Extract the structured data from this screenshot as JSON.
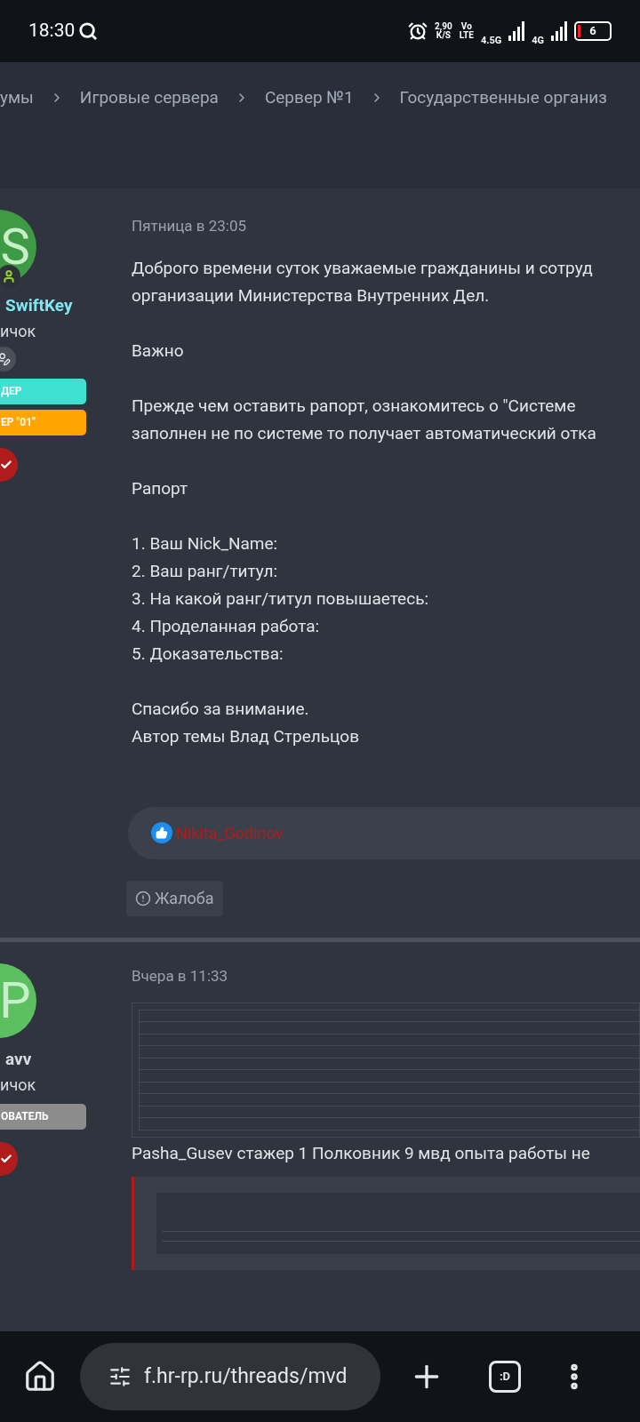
{
  "status_bar": {
    "time": "18:30",
    "speed": "2,90",
    "speed_unit": "K/S",
    "volte_top": "Vo",
    "volte_bottom": "LTE",
    "network_1": "4.5G",
    "network_2": "4G",
    "battery": "6"
  },
  "breadcrumbs": [
    "умы",
    "Игровые сервера",
    "Сервер №1",
    "Государственные организ"
  ],
  "posts": [
    {
      "author": {
        "text": "SwiftKey",
        "color": "#7fe6f2"
      },
      "title": "ичок",
      "avatar": {
        "letter": "S",
        "color": "#3e9a45"
      },
      "online": true,
      "banners": [
        {
          "label": "ДЕР",
          "color": "#40e0d0"
        },
        {
          "label": "ЕР \"01\"",
          "color": "#ffa500"
        }
      ],
      "date": "Пятница в 23:05",
      "paragraphs": [
        [
          "Доброго времени суток уважаемые гражданины и сотруд",
          "организации Министерства Внутренних Дел."
        ],
        [
          "Важно"
        ],
        [
          "Прежде чем оставить рапорт, ознакомитесь о \"Системе",
          "заполнен не по системе то получает автоматический отка"
        ],
        [
          "Рапорт"
        ],
        [
          "1. Ваш Nick_Name:",
          "2. Ваш ранг/титул:",
          "3. На какой ранг/титул повышаетесь:",
          "4. Проделанная работа:",
          "5. Доказательства:"
        ],
        [
          "Спасибо за внимание.",
          "Автор темы Влад Стрельцов"
        ]
      ],
      "likes": "Nikita_Godinov",
      "report": "Жалоба"
    },
    {
      "author": {
        "text": "avv",
        "color": "#d8dbe0"
      },
      "title": "ичок",
      "avatar": {
        "letter": "P",
        "color": "#5cbf60"
      },
      "online": false,
      "banners": [
        {
          "label": "ОВАТЕЛЬ",
          "color": "#8c8c8c"
        }
      ],
      "date": "Вчера в 11:33",
      "text": "Pasha_Gusev стажер 1 Полковник 9 мвд опыта работы не"
    }
  ],
  "browser": {
    "url": "f.hr-rp.ru/threads/mvd",
    "tabs": ":D"
  }
}
